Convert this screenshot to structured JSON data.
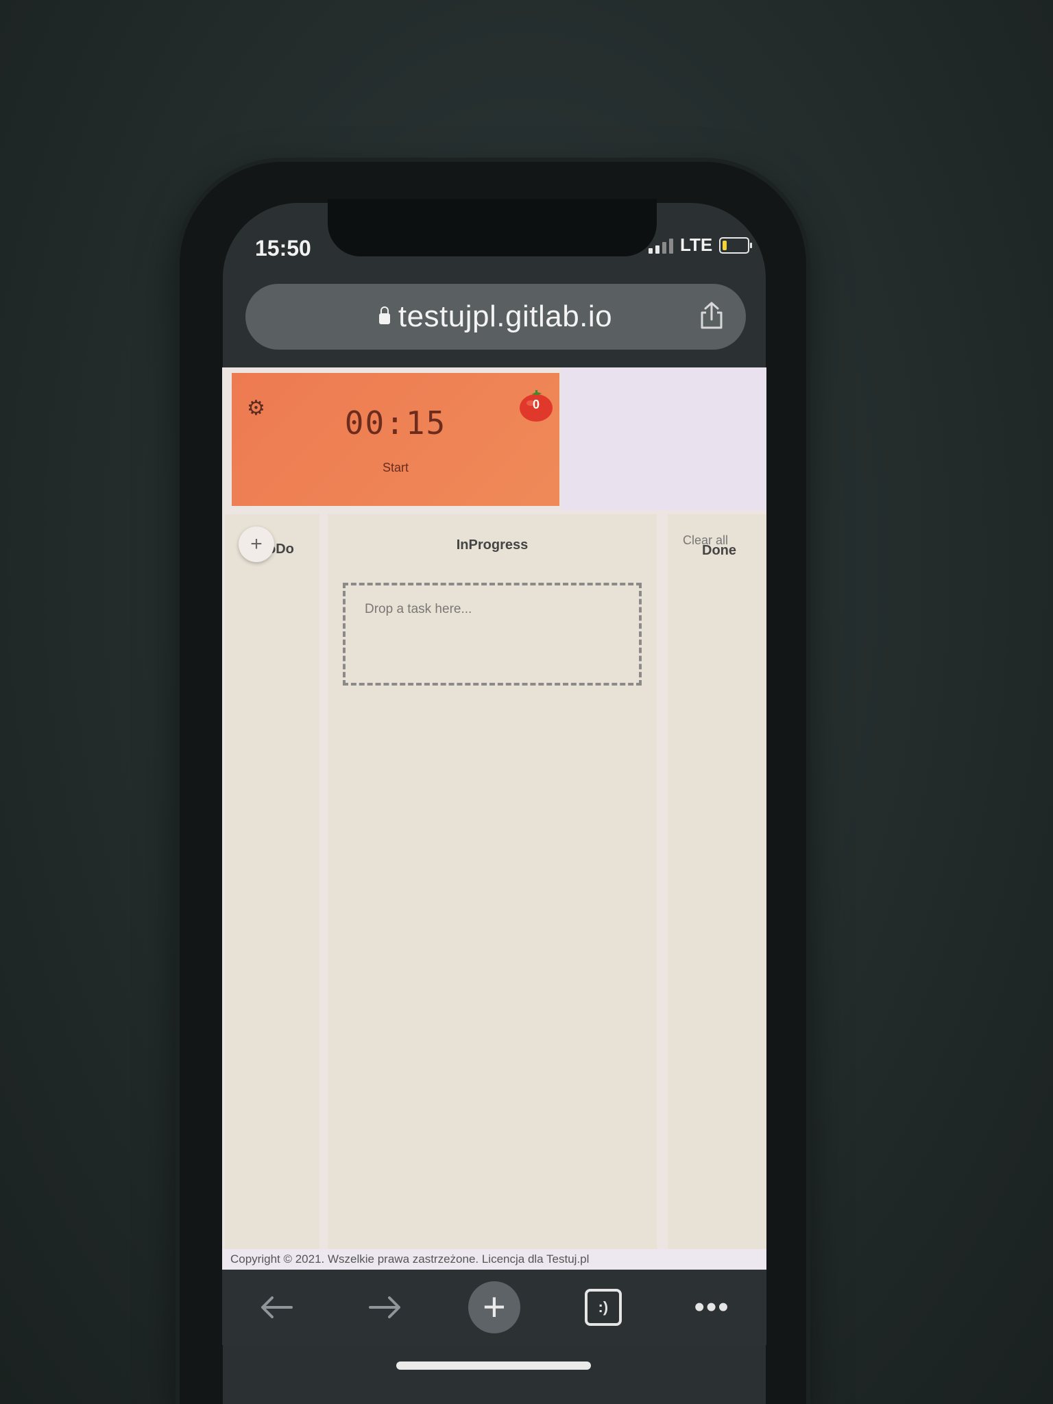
{
  "status_bar": {
    "time": "15:50",
    "network": "LTE"
  },
  "browser": {
    "url": "testujpl.gitlab.io",
    "toolbar_icons": [
      "back-arrow-icon",
      "forward-arrow-icon",
      "new-tab-plus-icon",
      "tabs-icon",
      "more-icon"
    ],
    "tabs_glyph": ":)"
  },
  "timer": {
    "display": "00:15",
    "start_label": "Start",
    "tomato_count": "0"
  },
  "board": {
    "columns": [
      {
        "title": "oDo",
        "add_label": "+"
      },
      {
        "title": "InProgress",
        "drop_placeholder": "Drop a task here..."
      },
      {
        "title": "Done",
        "clear_label": "Clear all"
      }
    ]
  },
  "footer": {
    "text": "Copyright © 2021. Wszelkie prawa zastrzeżone. Licencja dla Testuj.pl"
  },
  "colors": {
    "timer_bg": "#ee7a52",
    "column_bg": "#e8e2d6",
    "tomato": "#e0392b"
  }
}
